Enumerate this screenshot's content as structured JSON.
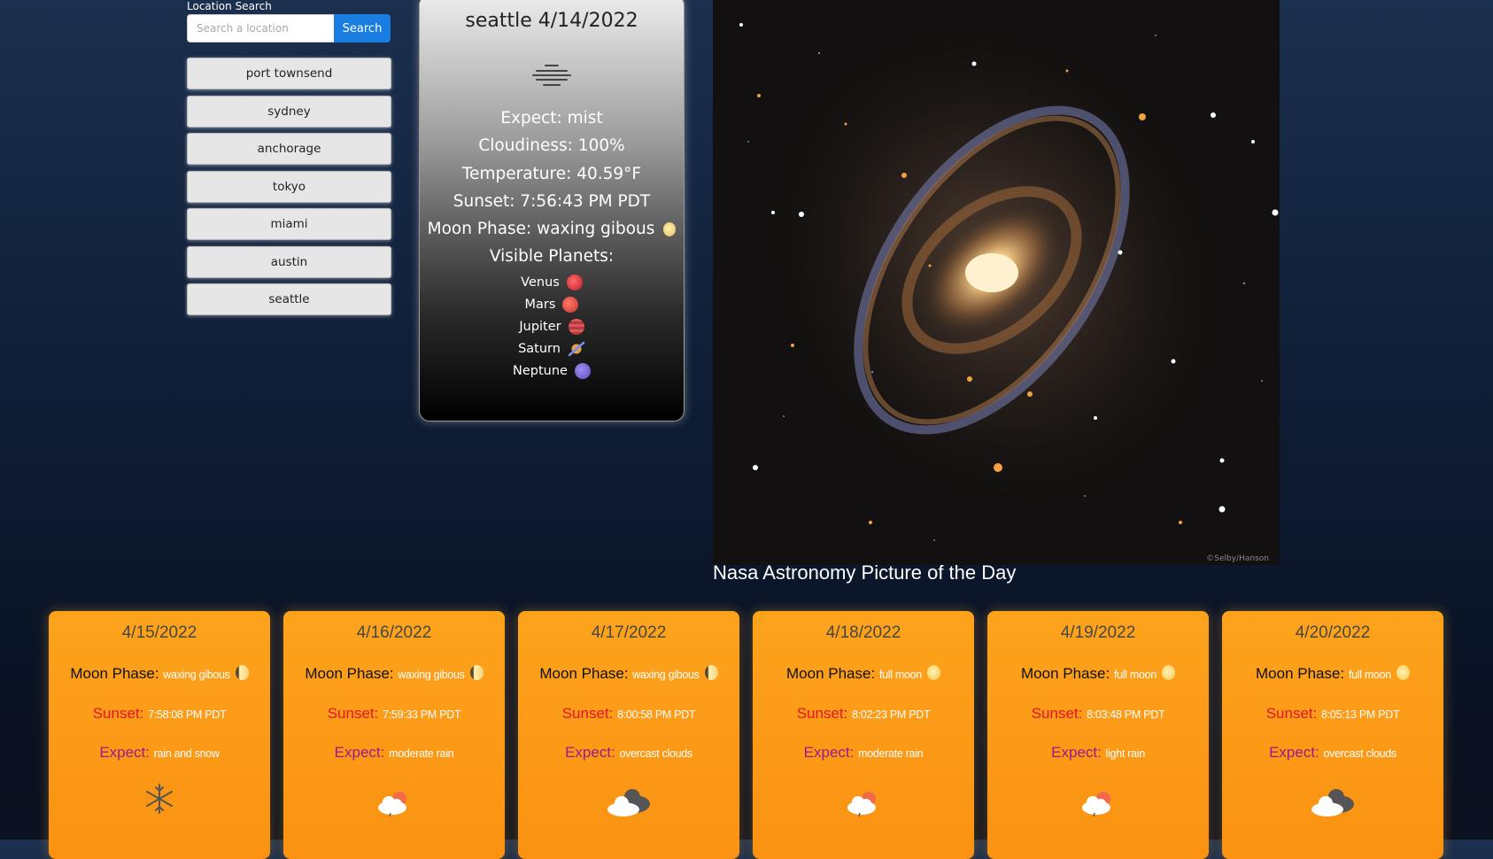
{
  "search": {
    "label": "Location Search",
    "placeholder": "Search a location",
    "button": "Search"
  },
  "history": [
    "port townsend",
    "sydney",
    "anchorage",
    "tokyo",
    "miami",
    "austin",
    "seattle"
  ],
  "current": {
    "title": "seattle 4/14/2022",
    "icon": "mist-icon",
    "expect": "Expect: mist",
    "cloudiness": "Cloudiness: 100%",
    "temperature": "Temperature: 40.59°F",
    "sunset": "Sunset: 7:56:43 PM PDT",
    "moon": "Moon Phase: waxing gibous",
    "planets_heading": "Visible Planets:",
    "planets": [
      {
        "name": "Venus",
        "color": "#d9303a"
      },
      {
        "name": "Mars",
        "color": "#d8403a"
      },
      {
        "name": "Jupiter",
        "color": "#c9464a"
      },
      {
        "name": "Saturn",
        "color": "#e8a54a"
      },
      {
        "name": "Neptune",
        "color": "#7a6ad8"
      }
    ]
  },
  "apod": {
    "caption": "Nasa Astronomy Picture of the Day",
    "credit": "©Selby/Hanson"
  },
  "forecast": {
    "moon_label": "Moon Phase:",
    "sunset_label": "Sunset:",
    "expect_label": "Expect:",
    "days": [
      {
        "date": "4/15/2022",
        "moon": "waxing gibous",
        "moon_icon": "waxing-gibbous",
        "sunset": "7:58:08 PM PDT",
        "expect": "rain and snow",
        "icon": "snowflake-icon"
      },
      {
        "date": "4/16/2022",
        "moon": "waxing gibous",
        "moon_icon": "waxing-gibbous",
        "sunset": "7:59:33 PM PDT",
        "expect": "moderate rain",
        "icon": "rain-cloud-icon"
      },
      {
        "date": "4/17/2022",
        "moon": "waxing gibous",
        "moon_icon": "waxing-gibbous",
        "sunset": "8:00:58 PM PDT",
        "expect": "overcast clouds",
        "icon": "overcast-cloud-icon"
      },
      {
        "date": "4/18/2022",
        "moon": "full moon",
        "moon_icon": "full-moon",
        "sunset": "8:02:23 PM PDT",
        "expect": "moderate rain",
        "icon": "rain-cloud-icon"
      },
      {
        "date": "4/19/2022",
        "moon": "full moon",
        "moon_icon": "full-moon",
        "sunset": "8:03:48 PM PDT",
        "expect": "light rain",
        "icon": "rain-cloud-icon"
      },
      {
        "date": "4/20/2022",
        "moon": "full moon",
        "moon_icon": "full-moon",
        "sunset": "8:05:13 PM PDT",
        "expect": "overcast clouds",
        "icon": "overcast-cloud-icon"
      }
    ]
  }
}
